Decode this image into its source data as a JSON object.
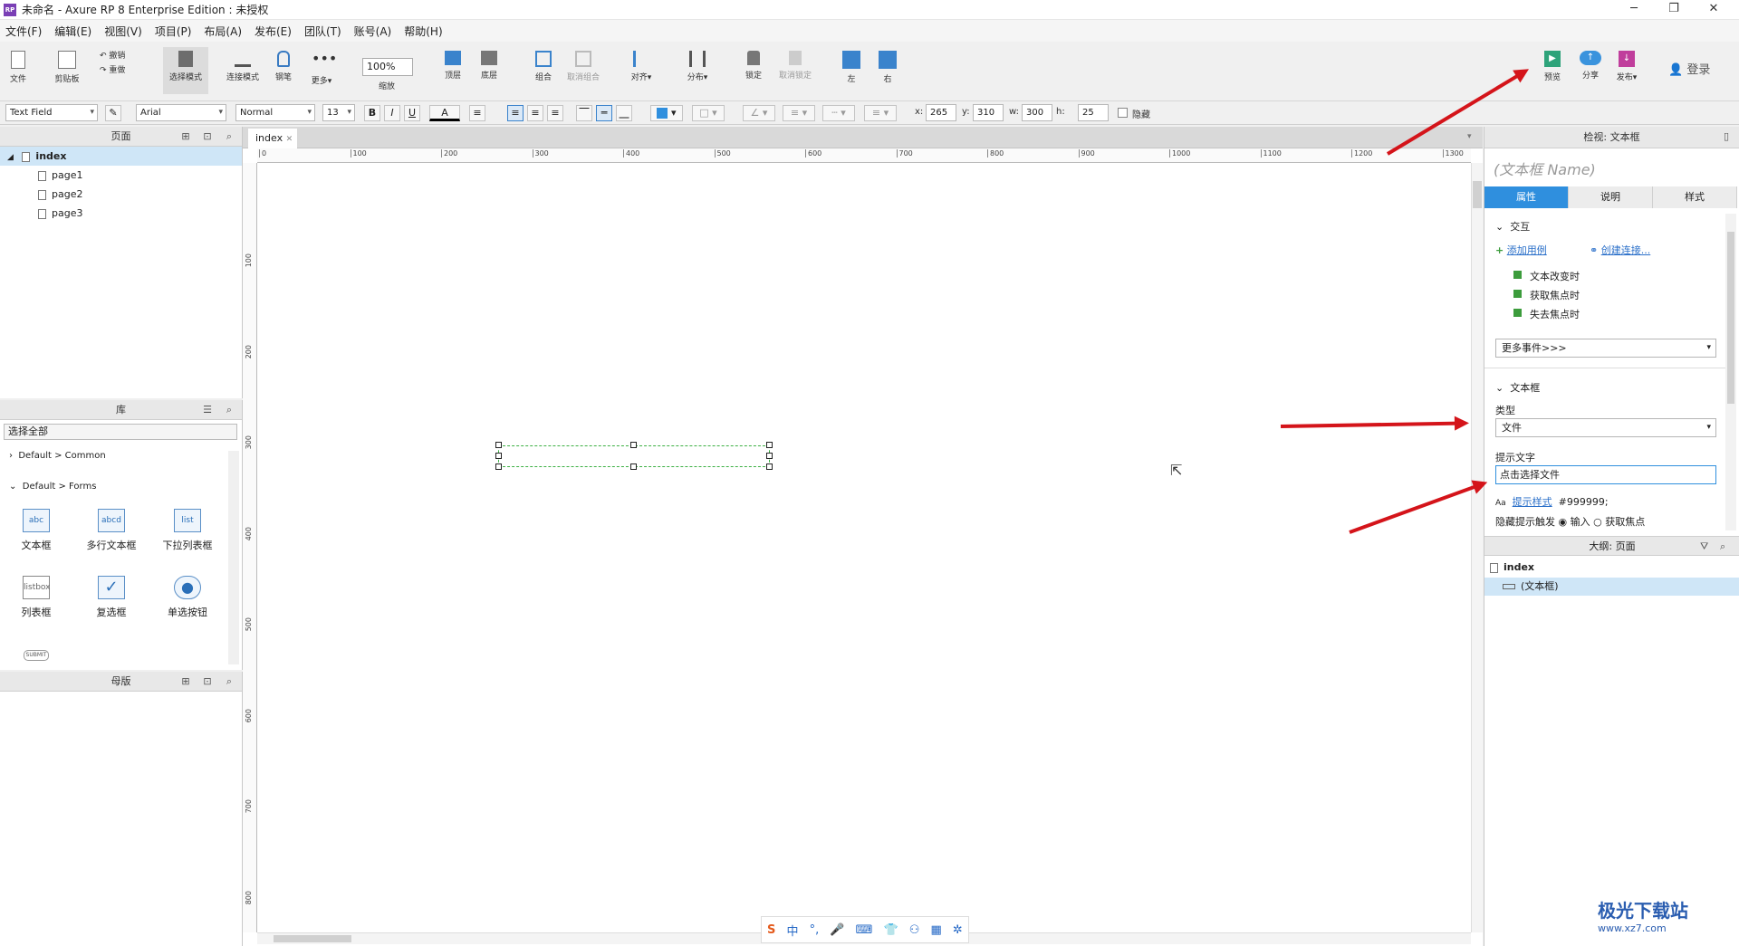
{
  "window": {
    "title": "未命名 - Axure RP 8 Enterprise Edition : 未授权",
    "app_icon": "RP"
  },
  "menu": [
    "文件(F)",
    "编辑(E)",
    "视图(V)",
    "项目(P)",
    "布局(A)",
    "发布(E)",
    "团队(T)",
    "账号(A)",
    "帮助(H)"
  ],
  "toolbar": {
    "file": "文件",
    "clipboard": "剪贴板",
    "undo": "撤销",
    "redo": "重做",
    "select_mode": "选择模式",
    "connect_mode": "连接模式",
    "pen": "钢笔",
    "more": "更多▾",
    "zoom_value": "100%",
    "zoom": "缩放",
    "top": "顶层",
    "bottom": "底层",
    "group": "组合",
    "ungroup": "取消组合",
    "align": "对齐▾",
    "distribute": "分布▾",
    "lock": "锁定",
    "unlock": "取消锁定",
    "left": "左",
    "right": "右",
    "preview": "预览",
    "share": "分享",
    "publish": "发布▾",
    "login": "登录"
  },
  "format": {
    "widget_type": "Text Field",
    "font": "Arial",
    "weight": "Normal",
    "size": "13",
    "bold": "B",
    "italic": "I",
    "underline": "U",
    "font_color": "A",
    "x_label": "x:",
    "x": "265",
    "y_label": "y:",
    "y": "310",
    "w_label": "w:",
    "w": "300",
    "h_label": "h:",
    "h": "25",
    "hide": "隐藏"
  },
  "pages_panel": {
    "title": "页面",
    "root": "index",
    "pages": [
      "page1",
      "page2",
      "page3"
    ]
  },
  "library_panel": {
    "title": "库",
    "filter": "选择全部",
    "groups": [
      "Default > Common",
      "Default > Forms"
    ],
    "widgets": [
      {
        "label": "文本框",
        "icon": "abc"
      },
      {
        "label": "多行文本框",
        "icon": "abcd"
      },
      {
        "label": "下拉列表框",
        "icon": "list"
      },
      {
        "label": "列表框",
        "icon": "listbox"
      },
      {
        "label": "复选框",
        "icon": "✓"
      },
      {
        "label": "单选按钮",
        "icon": "●"
      }
    ],
    "submit_icon": "SUBMIT"
  },
  "masters_panel": {
    "title": "母版"
  },
  "canvas": {
    "tab": "index",
    "ruler_h": [
      "0",
      "100",
      "200",
      "300",
      "400",
      "500",
      "600",
      "700",
      "800",
      "900",
      "1000",
      "1100",
      "1200",
      "1300"
    ],
    "ruler_v": [
      "100",
      "200",
      "300",
      "400",
      "500",
      "600",
      "700",
      "800"
    ]
  },
  "inspector": {
    "title": "检视: 文本框",
    "name_placeholder": "(文本框 Name)",
    "tabs": [
      "属性",
      "说明",
      "样式"
    ],
    "interaction_section": "交互",
    "add_case": "添加用例",
    "create_link": "创建连接...",
    "events": [
      "文本改变时",
      "获取焦点时",
      "失去焦点时"
    ],
    "more_events": "更多事件>>>",
    "textbox_section": "文本框",
    "type_label": "类型",
    "type_value": "文件",
    "hint_label": "提示文字",
    "hint_value": "点击选择文件",
    "hint_style_prefix": "Aa",
    "hint_style": "提示样式",
    "hint_color": "#999999;",
    "hide_hint_label": "隐藏提示触发",
    "hide_hint_opt1": "输入",
    "hide_hint_opt2": "获取焦点"
  },
  "outline": {
    "title": "大纲: 页面",
    "root": "index",
    "child": "(文本框)"
  },
  "ime": {
    "items": [
      "中",
      "°,",
      "🎤",
      "⌨",
      "👕",
      "⚇",
      "▦",
      "✲"
    ]
  },
  "watermark": {
    "text": "极光下载站",
    "url": "www.xz7.com"
  },
  "colors": {
    "accent": "#2f8fde",
    "arrow": "#d4141a",
    "selection": "#3cb043"
  }
}
